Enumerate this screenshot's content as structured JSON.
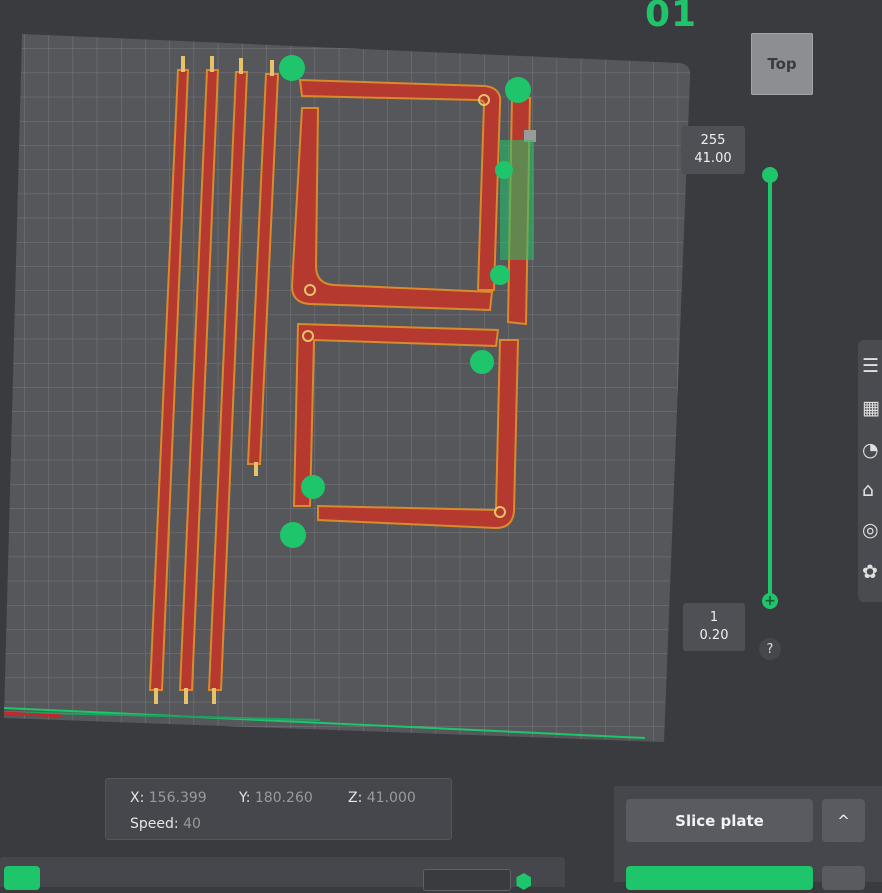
{
  "header": {
    "plate_number": "01",
    "plate_extra": ""
  },
  "view_cube": {
    "label": "Top"
  },
  "layer_slider": {
    "top_layer": "255",
    "top_height": "41.00",
    "bottom_layer": "1",
    "bottom_height": "0.20",
    "help": "?"
  },
  "right_toolbar": {
    "icons": [
      "layers-icon",
      "plate-icon",
      "gauge-icon",
      "support-icon",
      "disc-icon",
      "grid-icon"
    ]
  },
  "coords": {
    "x_label": "X:",
    "x_value": "156.399",
    "y_label": "Y:",
    "y_value": "180.260",
    "z_label": "Z:",
    "z_value": "41.000",
    "speed_label": "Speed:",
    "speed_value": "40"
  },
  "actions": {
    "slice_label": "Slice plate",
    "caret": "^"
  },
  "colors": {
    "accent": "#1fc56a",
    "background": "#3a3b3f",
    "plate": "#56575b",
    "wall": "#b5392e",
    "perimeter": "#d98a2c"
  }
}
